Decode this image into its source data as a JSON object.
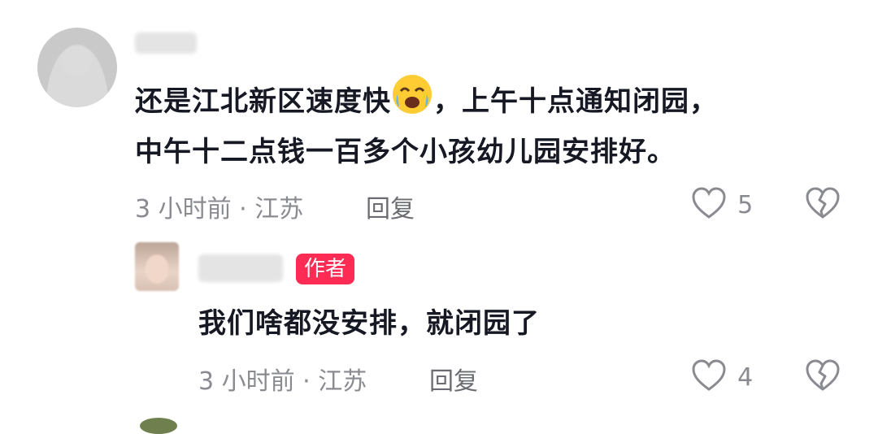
{
  "comments": [
    {
      "text_line1_a": "还是江北新区速度快",
      "emoji": "crying-laughing-emoji",
      "text_line1_b": "，上午十点通知闭园，",
      "text_line2": "中午十二点钱一百多个小孩幼儿园安排好。",
      "meta": "3 小时前 · 江苏",
      "reply_label": "回复",
      "like_count": "5"
    }
  ],
  "replies": [
    {
      "author_tag": "作者",
      "text": "我们啥都没安排，就闭园了",
      "meta": "3 小时前 · 江苏",
      "reply_label": "回复",
      "like_count": "4"
    }
  ],
  "colors": {
    "accent": "#fe2c55",
    "muted": "#8a8b91"
  }
}
